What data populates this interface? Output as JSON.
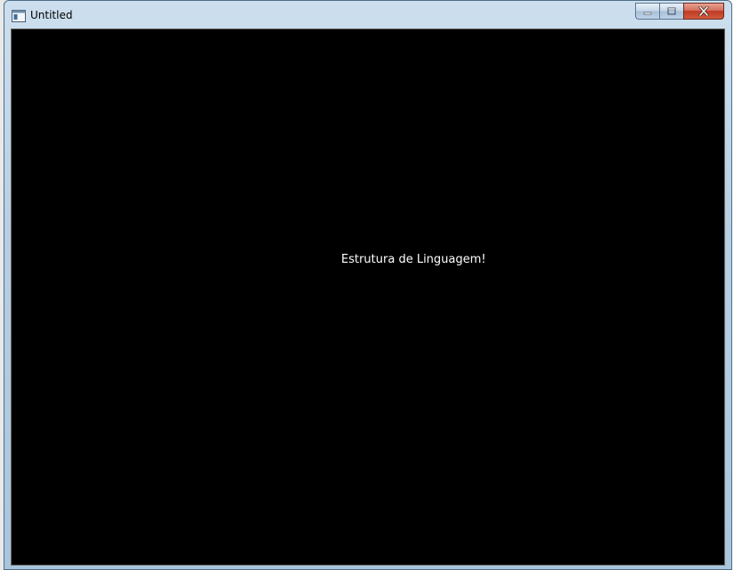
{
  "window": {
    "title": "Untitled",
    "icon": "application-window-icon"
  },
  "caption_buttons": {
    "minimize_icon": "minimize-icon",
    "maximize_icon": "maximize-icon",
    "close_icon": "close-icon"
  },
  "client": {
    "message": "Estrutura de Linguagem!",
    "background_color": "#000000",
    "text_color": "#ffffff"
  }
}
